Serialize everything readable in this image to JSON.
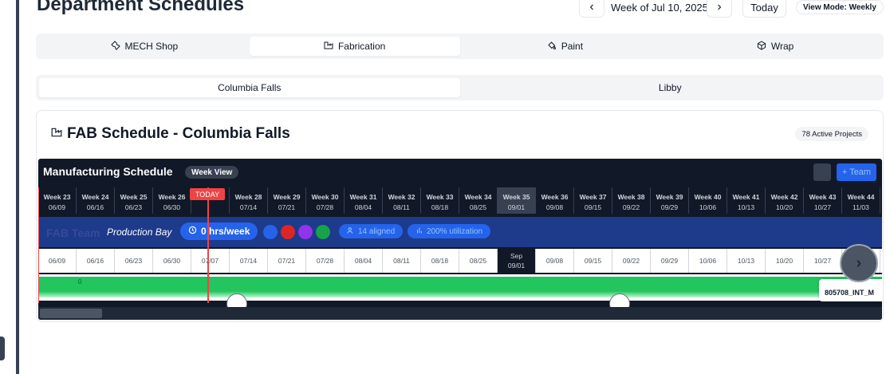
{
  "page": {
    "title": "Department Schedules"
  },
  "header": {
    "prev_label": "‹",
    "week_label": "Week of Jul 10, 2025",
    "next_label": "›",
    "today_label": "Today",
    "view_mode_label": "View Mode: Weekly"
  },
  "departments": [
    {
      "label": "MECH Shop",
      "icon": "wrench-icon",
      "active": false
    },
    {
      "label": "Fabrication",
      "icon": "factory-icon",
      "active": true
    },
    {
      "label": "Paint",
      "icon": "paint-bucket-icon",
      "active": false
    },
    {
      "label": "Wrap",
      "icon": "package-icon",
      "active": false
    }
  ],
  "locations": [
    {
      "label": "Columbia Falls",
      "active": true
    },
    {
      "label": "Libby",
      "active": false
    }
  ],
  "card": {
    "title": "FAB Schedule - Columbia Falls",
    "active_projects": "78 Active Projects"
  },
  "schedule": {
    "title": "Manufacturing Schedule",
    "view_badge": "Week View",
    "team_button": "+ Team",
    "today_label": "TODAY",
    "weeks": [
      {
        "label": "Week 23",
        "date": "06/09"
      },
      {
        "label": "Week 24",
        "date": "06/16"
      },
      {
        "label": "Week 25",
        "date": "06/23"
      },
      {
        "label": "Week 26",
        "date": "06/30"
      },
      {
        "label": "",
        "date": "07/07"
      },
      {
        "label": "Week 28",
        "date": "07/14"
      },
      {
        "label": "Week 29",
        "date": "07/21"
      },
      {
        "label": "Week 30",
        "date": "07/28"
      },
      {
        "label": "Week 31",
        "date": "08/04"
      },
      {
        "label": "Week 32",
        "date": "08/11"
      },
      {
        "label": "Week 33",
        "date": "08/18"
      },
      {
        "label": "Week 34",
        "date": "08/25"
      },
      {
        "label": "Week 35",
        "date": "09/01"
      },
      {
        "label": "Week 36",
        "date": "09/08"
      },
      {
        "label": "Week 37",
        "date": "09/15"
      },
      {
        "label": "Week 38",
        "date": "09/22"
      },
      {
        "label": "Week 39",
        "date": "09/29"
      },
      {
        "label": "Week 40",
        "date": "10/06"
      },
      {
        "label": "Week 41",
        "date": "10/13"
      },
      {
        "label": "Week 42",
        "date": "10/20"
      },
      {
        "label": "Week 43",
        "date": "10/27"
      },
      {
        "label": "Week 44",
        "date": "11/03"
      }
    ],
    "current_week_index": 12,
    "current_month_label": "Sep",
    "team": {
      "name": "FAB Team",
      "subtitle": "Production Bay",
      "hours": "0 hrs/week",
      "assigned": "14 aligned",
      "utilization": "200% utilization"
    },
    "bar_zero_label": "0",
    "project_label": "805708_INT_M"
  },
  "colors": {
    "schedule_bg": "#111827",
    "team_row": "#1e3a8a",
    "accent_blue": "#2563eb",
    "today_red": "#ef4444",
    "bar_green": "#22c55e"
  }
}
